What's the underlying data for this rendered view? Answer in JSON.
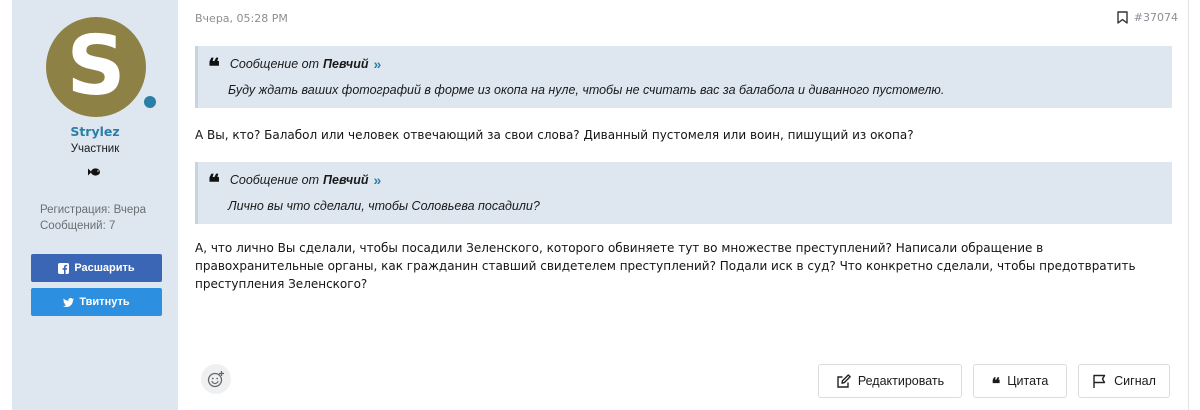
{
  "user": {
    "avatar_letter": "S",
    "avatar_color": "#8d8146",
    "online_color": "#2a7fa8",
    "name": "Strylez",
    "title": "Участник",
    "rank_icon": "fish-icon",
    "registration": "Регистрация: Вчера",
    "messages": "Сообщений: 7"
  },
  "share": {
    "facebook_label": "Расшарить",
    "twitter_label": "Твитнуть"
  },
  "post": {
    "date": "Вчера, 05:28 PM",
    "number": "#37074",
    "quotes": [
      {
        "prefix": "Сообщение от",
        "author": "Певчий",
        "text": "Буду ждать ваших фотографий в форме из окопа на нуле, чтобы не считать вас за балабола и диванного пустомелю."
      },
      {
        "prefix": "Сообщение от",
        "author": "Певчий",
        "text": "Лично вы что сделали, чтобы Соловьева посадили?"
      }
    ],
    "paragraphs": [
      "А Вы, кто? Балабол или человек отвечающий за свои слова? Диванный пустомеля или воин, пишущий из окопа?",
      "А, что лично Вы сделали, чтобы посадили Зеленского, которого обвиняете тут во множестве преступлений? Написали обращение в правохранительные органы, как гражданин ставший свидетелем преступлений? Подали иск в суд? Что конкретно сделали, чтобы предотвратить преступления Зеленского?"
    ]
  },
  "actions": {
    "edit_label": "Редактировать",
    "quote_label": "Цитата",
    "report_label": "Сигнал"
  },
  "colors": {
    "sidebar_bg": "#dee7f0",
    "quote_bg": "#dee7f0",
    "link": "#2a7fa8",
    "facebook": "#3b66b6",
    "twitter": "#2d8fe0"
  }
}
